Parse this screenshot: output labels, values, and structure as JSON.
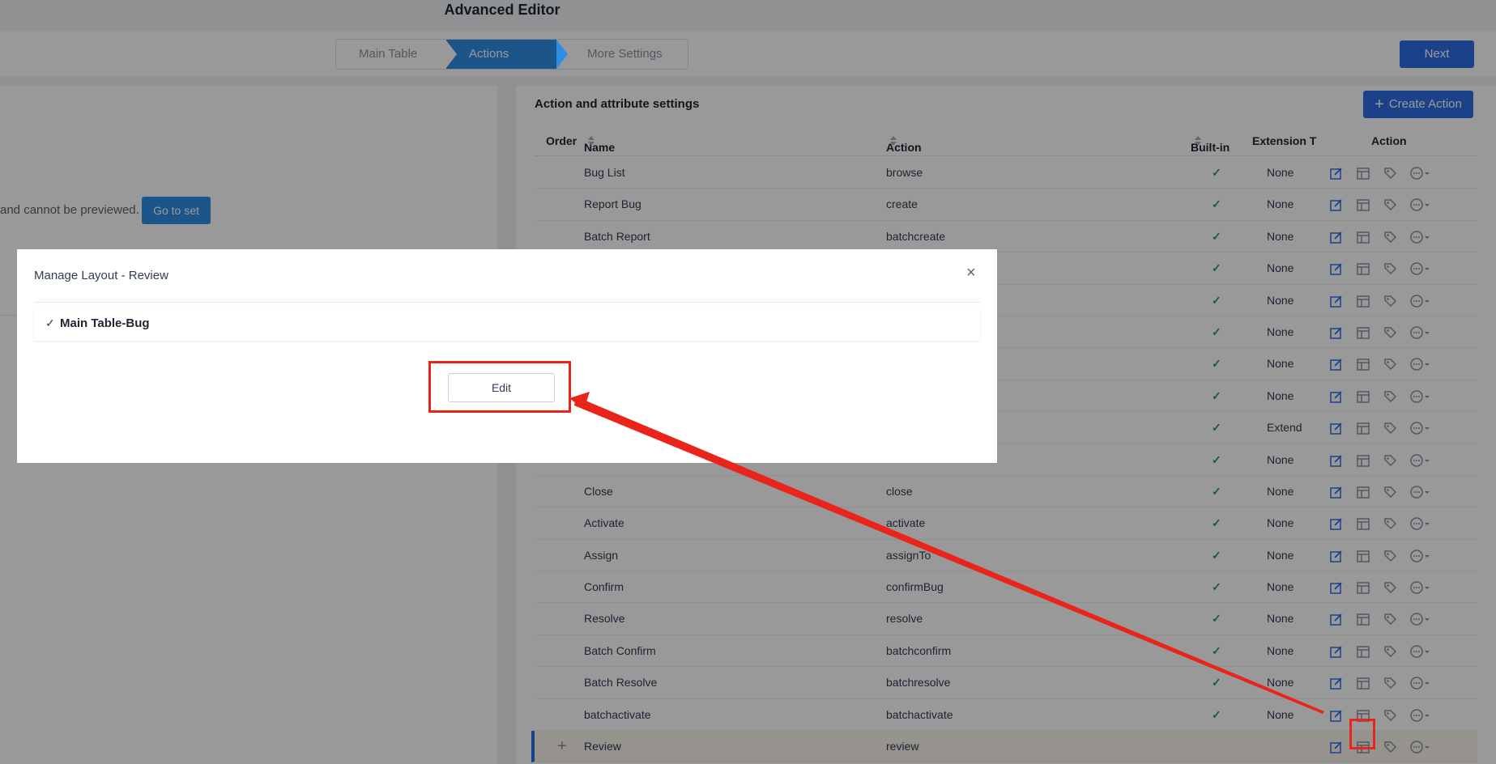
{
  "app": {
    "title": "Advanced Editor",
    "next_label": "Next"
  },
  "steps": [
    "Main Table",
    "Actions",
    "More Settings"
  ],
  "left": {
    "preview_msg": "and cannot be previewed.",
    "goto_label": "Go to set"
  },
  "right": {
    "title": "Action and attribute settings",
    "create_label": "Create Action",
    "headers": {
      "order": "Order",
      "name": "Name",
      "action": "Action",
      "builtin": "Built-in",
      "extension": "Extension T",
      "ops": "Action"
    },
    "rows": [
      {
        "name": "Bug List",
        "action": "browse",
        "builtin": "✓",
        "ext": "None"
      },
      {
        "name": "Report Bug",
        "action": "create",
        "builtin": "✓",
        "ext": "None"
      },
      {
        "name": "Batch Report",
        "action": "batchcreate",
        "builtin": "✓",
        "ext": "None"
      },
      {
        "name": "",
        "action": "",
        "builtin": "✓",
        "ext": "None"
      },
      {
        "name": "",
        "action": "",
        "builtin": "✓",
        "ext": "None"
      },
      {
        "name": "",
        "action": "",
        "builtin": "✓",
        "ext": "None"
      },
      {
        "name": "",
        "action": "",
        "builtin": "✓",
        "ext": "None"
      },
      {
        "name": "",
        "action": "",
        "builtin": "✓",
        "ext": "None"
      },
      {
        "name": "",
        "action": "",
        "builtin": "✓",
        "ext": "Extend"
      },
      {
        "name": "",
        "action": "",
        "builtin": "✓",
        "ext": "None"
      },
      {
        "name": "Close",
        "action": "close",
        "builtin": "✓",
        "ext": "None"
      },
      {
        "name": "Activate",
        "action": "activate",
        "builtin": "✓",
        "ext": "None"
      },
      {
        "name": "Assign",
        "action": "assignTo",
        "builtin": "✓",
        "ext": "None"
      },
      {
        "name": "Confirm",
        "action": "confirmBug",
        "builtin": "✓",
        "ext": "None"
      },
      {
        "name": "Resolve",
        "action": "resolve",
        "builtin": "✓",
        "ext": "None"
      },
      {
        "name": "Batch Confirm",
        "action": "batchconfirm",
        "builtin": "✓",
        "ext": "None"
      },
      {
        "name": "Batch Resolve",
        "action": "batchresolve",
        "builtin": "✓",
        "ext": "None"
      },
      {
        "name": "batchactivate",
        "action": "batchactivate",
        "builtin": "✓",
        "ext": "None"
      },
      {
        "name": "Review",
        "action": "review",
        "builtin": "",
        "ext": ""
      }
    ],
    "op_icons": [
      "edit-icon",
      "layout-icon",
      "tag-icon",
      "more-icon"
    ]
  },
  "modal": {
    "title": "Manage Layout - Review",
    "close": "×",
    "item_check": "✓",
    "item_label": "Main Table-Bug",
    "edit_label": "Edit"
  },
  "colors": {
    "primary": "#2e6fe4",
    "step_active": "#2e8ee4",
    "highlight": "#e8241b",
    "check": "#2e9b52"
  }
}
